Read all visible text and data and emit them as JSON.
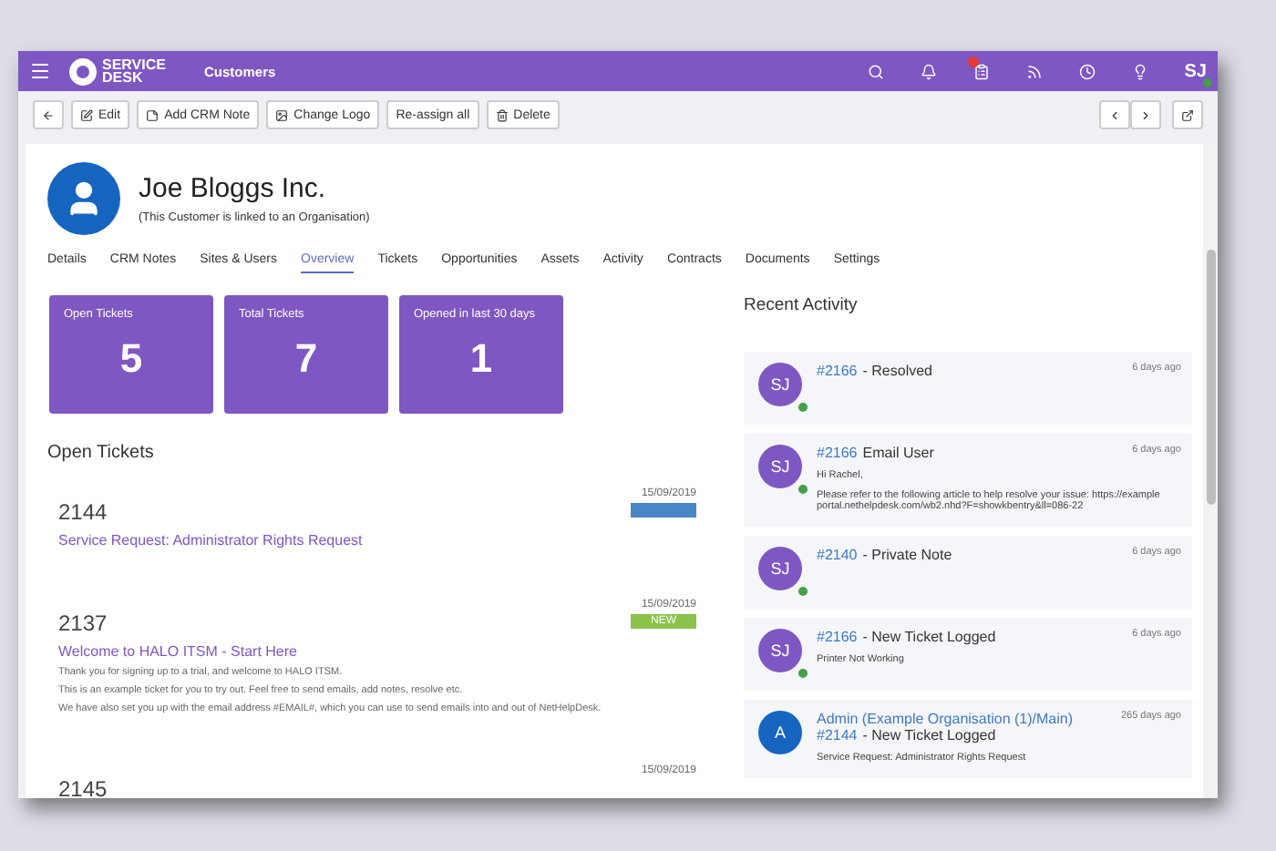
{
  "topbar": {
    "logo": "SERVICE DESK",
    "section": "Customers",
    "user": "SJ",
    "user_online": true
  },
  "toolbar": {
    "buttons": [
      {
        "kind": "back"
      },
      {
        "kind": "edit",
        "label": "Edit"
      },
      {
        "kind": "note",
        "label": "Add CRM Note"
      },
      {
        "kind": "image",
        "label": "Change Logo"
      },
      {
        "kind": "plain",
        "label": "Re-assign all"
      },
      {
        "kind": "delete",
        "label": "Delete"
      }
    ]
  },
  "customer": {
    "name": "Joe Bloggs Inc.",
    "subtitle": "(This Customer is linked to an Organisation)"
  },
  "tabs": [
    {
      "label": "Details",
      "selected": false
    },
    {
      "label": "CRM Notes",
      "selected": false
    },
    {
      "label": "Sites & Users",
      "selected": false
    },
    {
      "label": "Overview",
      "selected": true
    },
    {
      "label": "Tickets",
      "selected": false
    },
    {
      "label": "Opportunities",
      "selected": false
    },
    {
      "label": "Assets",
      "selected": false
    },
    {
      "label": "Activity",
      "selected": false
    },
    {
      "label": "Contracts",
      "selected": false
    },
    {
      "label": "Documents",
      "selected": false
    },
    {
      "label": "Settings",
      "selected": false
    }
  ],
  "stats": [
    {
      "label": "Open Tickets",
      "value": "5"
    },
    {
      "label": "Total Tickets",
      "value": "7"
    },
    {
      "label": "Opened in last 30 days",
      "value": "1"
    }
  ],
  "open_tickets": {
    "title": "Open Tickets",
    "tickets": [
      {
        "id": "2144",
        "date": "15/09/2019",
        "badge": {
          "color": "#4a86c5"
        },
        "summary": "Service Request: Administrator Rights Request"
      },
      {
        "id": "2137",
        "date": "15/09/2019",
        "badge": {
          "text": "NEW",
          "color": "#8bc34a"
        },
        "summary": "Welcome to HALO ITSM - Start Here",
        "details": [
          "Thank you for signing up to a trial, and welcome to HALO ITSM.",
          "This is an example ticket for you to try out. Feel free to send emails, add notes, resolve etc.",
          "We have also set you up with the email address #EMAIL#, which you can use to send emails into and out of NetHelpDesk."
        ]
      },
      {
        "id": "2145",
        "date": "15/09/2019"
      }
    ]
  },
  "recent_activity": {
    "title": "Recent Activity",
    "items": [
      {
        "avatar": "SJ",
        "color": "#7e57c2",
        "online": true,
        "ticket": "#2166",
        "title": "- Resolved",
        "time": "6 days ago"
      },
      {
        "avatar": "SJ",
        "color": "#7e57c2",
        "online": true,
        "ticket": "#2166",
        "title": "Email User",
        "time": "6 days ago",
        "lines": [
          "Hi Rachel,",
          "Please refer to the following article to help resolve your issue: https://example portal.nethelpdesk.com/wb2.nhd?F=showkbentry&ll=086-22"
        ]
      },
      {
        "avatar": "SJ",
        "color": "#7e57c2",
        "online": true,
        "ticket": "#2140",
        "title": "- Private Note",
        "time": "6 days ago"
      },
      {
        "avatar": "SJ",
        "color": "#7e57c2",
        "online": true,
        "ticket": "#2166",
        "title": "- New Ticket Logged",
        "time": "6 days ago",
        "lines": [
          "Printer Not Working"
        ]
      },
      {
        "avatar": "A",
        "color": "#1565c0",
        "online": false,
        "agent": "Admin (Example Organisation (1)/Main)",
        "ticket": "#2144",
        "title": "- New Ticket Logged",
        "time": "265 days ago",
        "lines": [
          "Service Request: Administrator Rights Request"
        ]
      }
    ]
  }
}
